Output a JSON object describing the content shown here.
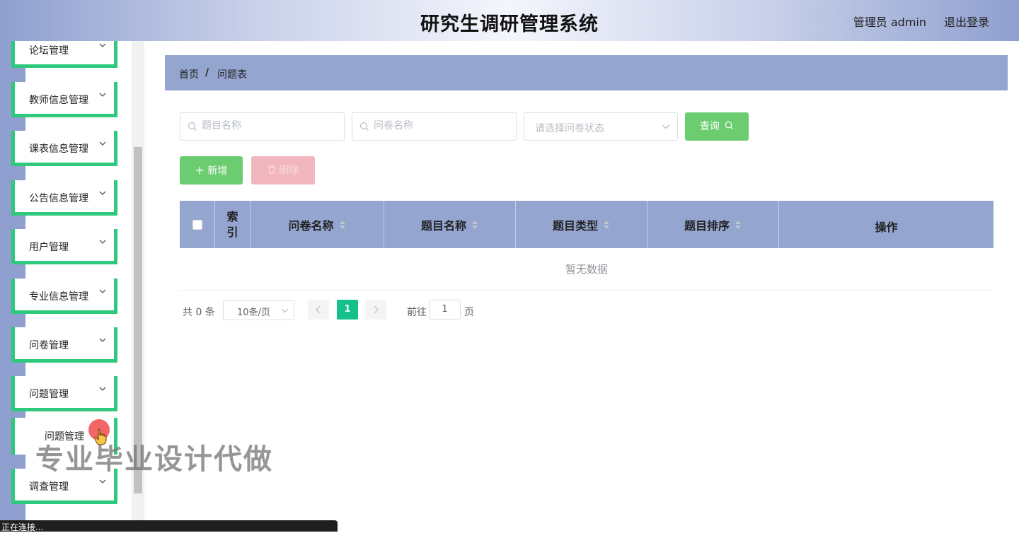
{
  "header": {
    "title": "研究生调研管理系统",
    "user": "管理员 admin",
    "logout": "退出登录"
  },
  "sidebar": {
    "items": [
      {
        "label": "论坛管理"
      },
      {
        "label": "教师信息管理"
      },
      {
        "label": "课表信息管理"
      },
      {
        "label": "公告信息管理"
      },
      {
        "label": "用户管理"
      },
      {
        "label": "专业信息管理"
      },
      {
        "label": "问卷管理"
      },
      {
        "label": "问题管理"
      },
      {
        "label": "调查管理"
      }
    ],
    "active_sub_item": "问题管理"
  },
  "breadcrumb": {
    "home": "首页",
    "separator": "/",
    "current": "问题表"
  },
  "search": {
    "title_placeholder": "题目名称",
    "questionnaire_placeholder": "问卷名称",
    "status_placeholder": "请选择问卷状态",
    "query_label": "查询"
  },
  "actions": {
    "add_label": "新增",
    "delete_label": "删除"
  },
  "table": {
    "columns": [
      "索引",
      "问卷名称",
      "题目名称",
      "题目类型",
      "题目排序",
      "操作"
    ],
    "empty_text": "暂无数据"
  },
  "pagination": {
    "total": "共 0 条",
    "page_size": "10条/页",
    "current_page": "1",
    "goto_label": "前往",
    "goto_value": "1",
    "page_unit": "页"
  },
  "overlay": {
    "watermark": "专业毕业设计代做",
    "status_text": "正在连接..."
  },
  "colors": {
    "accent_green": "#2fc97e",
    "header_blue": "#94a5d0",
    "button_green": "#6ccd70",
    "page_active": "#16c08a"
  }
}
